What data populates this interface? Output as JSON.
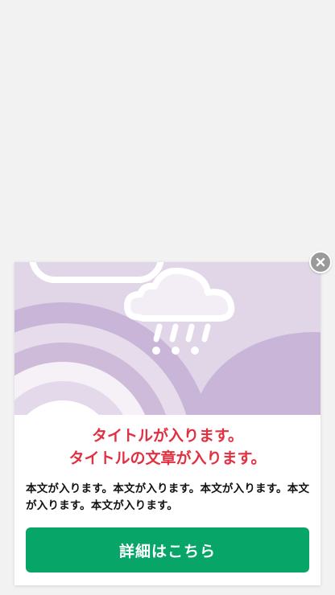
{
  "popup": {
    "title_lines": [
      "タイトルが入ります。",
      "タイトルの文章が入ります。"
    ],
    "body": "本文が入ります。本文が入ります。本文が入ります。本文が入ります。本文が入ります。",
    "button_label": "詳細はこちら",
    "close_icon": "close-icon",
    "hero_icon": "rain-cloud-icon"
  },
  "colors": {
    "page_background": "#f2f2f2",
    "title": "#e1303f",
    "button": "#07a568",
    "hero_background": "#e0d6e8",
    "hero_mid": "#c9b5d7",
    "close_button": "#9a9a9a"
  }
}
